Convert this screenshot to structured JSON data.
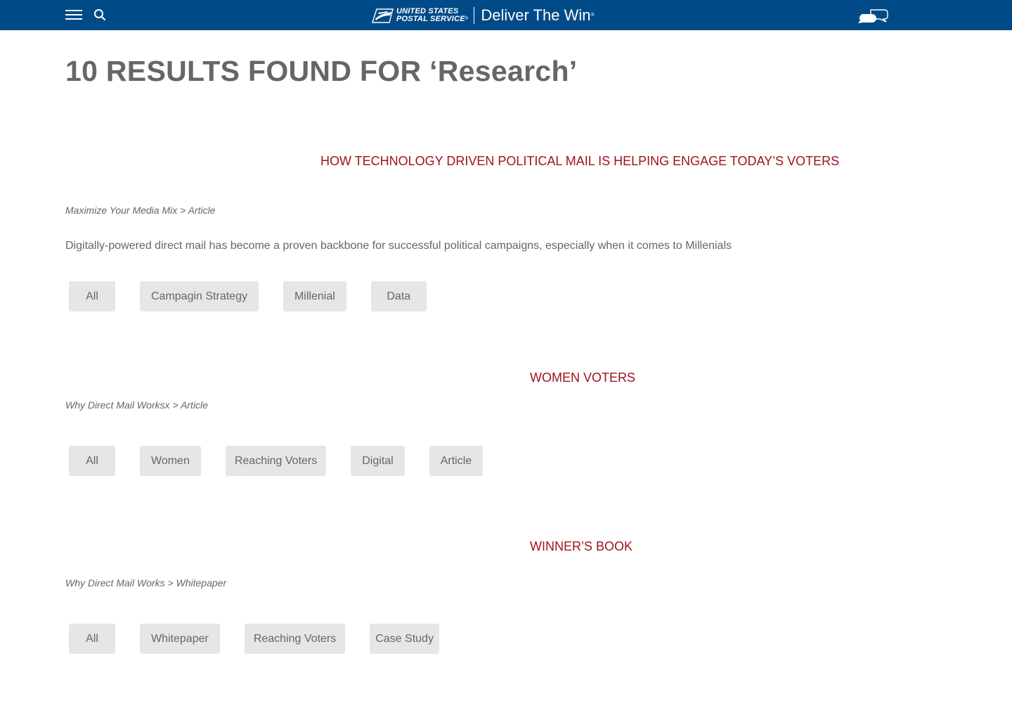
{
  "header": {
    "brand_line1": "UNITED STATES",
    "brand_line2": "POSTAL SERVICE",
    "tagline": "Deliver The Win",
    "colors": {
      "bar": "#004b87"
    },
    "icons": [
      "menu-icon",
      "search-icon",
      "eagle-logo-icon",
      "chat-icon"
    ]
  },
  "page": {
    "title": "10 RESULTS FOUND FOR ‘Research’"
  },
  "results": [
    {
      "title": "HOW TECHNOLOGY DRIVEN POLITICAL MAIL IS HELPING ENGAGE TODAY’S VOTERS",
      "breadcrumb": "Maximize Your Media Mix > Article",
      "description": "Digitally-powered direct mail has become a proven backbone for successful political campaigns, especially when it comes to Millenials",
      "tags": [
        "All",
        "Campagin Strategy",
        "Millenial",
        "Data"
      ]
    },
    {
      "title": "WOMEN VOTERS",
      "breadcrumb": "Why Direct Mail Worksx > Article",
      "tags": [
        "All",
        "Women",
        "Reaching Voters",
        "Digital",
        "Article"
      ]
    },
    {
      "title": "WINNER’S BOOK",
      "breadcrumb": "Why Direct Mail Works > Whitepaper",
      "tags": [
        "All",
        "Whitepaper",
        "Reaching Voters",
        "Case Study"
      ]
    }
  ],
  "colors": {
    "result_title": "#a0121d",
    "tag_bg": "#e6e6e6",
    "text": "#666666"
  }
}
